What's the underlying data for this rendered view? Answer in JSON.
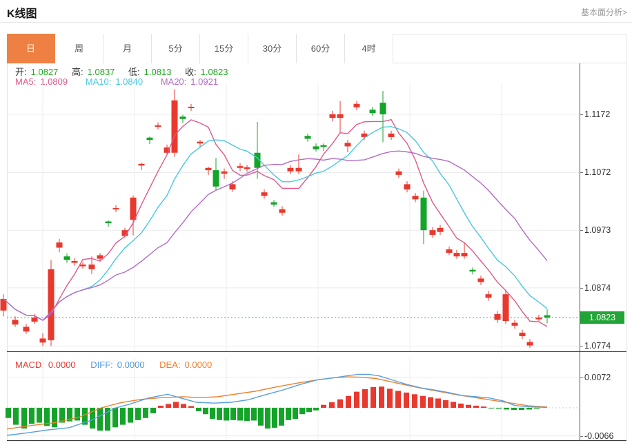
{
  "header": {
    "title": "K线图",
    "link": "基本面分析>"
  },
  "tabs": {
    "items": [
      "日",
      "周",
      "月",
      "5分",
      "15分",
      "30分",
      "60分",
      "4时"
    ],
    "active_index": 0
  },
  "ohlc": {
    "open_label": "开:",
    "open": "1.0827",
    "high_label": "高:",
    "high": "1.0837",
    "low_label": "低:",
    "low": "1.0813",
    "close_label": "收:",
    "close": "1.0823"
  },
  "ma": {
    "ma5_label": "MA5:",
    "ma5": "1.0809",
    "ma10_label": "MA10:",
    "ma10": "1.0840",
    "ma20_label": "MA20:",
    "ma20": "1.0921"
  },
  "macd_header": {
    "macd_label": "MACD:",
    "macd": "0.0000",
    "diff_label": "DIFF:",
    "diff": "0.0000",
    "dea_label": "DEA:",
    "dea": "0.0000"
  },
  "axis": {
    "main_ticks": [
      "1.1172",
      "1.1072",
      "1.0973",
      "1.0874",
      "1.0774"
    ],
    "last_price": "1.0823",
    "macd_tick_high": "0.0072",
    "macd_tick_low": "-0.0066"
  },
  "colors": {
    "up": "#e9382e",
    "down": "#14a42a",
    "badge": "#22a436",
    "ma5": "#e05788",
    "ma10": "#45c8e0",
    "ma20": "#b26bc5",
    "diff": "#58a0dd",
    "dea": "#ee7f2d",
    "active_tab": "#ee8043",
    "grid": "#ececec",
    "dotted_price": "#3cb954",
    "macd_zero_dotted": "#aed0ee",
    "ohlc_value": "#21a821"
  },
  "chart_data": {
    "type": "candlestick_with_macd",
    "main": {
      "title": "",
      "ylim": [
        1.0765,
        1.1224
      ],
      "tick_prices": [
        1.1172,
        1.1072,
        1.0973,
        1.0874,
        1.0774
      ],
      "last_price": 1.0823,
      "grid_x": [
        62,
        195,
        328,
        461,
        594,
        727
      ],
      "ma_periods": [
        5,
        10,
        20
      ],
      "candles": [
        [
          5,
          1.0835,
          1.0863,
          1.0825,
          1.0855
        ],
        [
          22,
          1.0811,
          1.0825,
          1.0807,
          1.0819
        ],
        [
          38,
          1.0799,
          1.0812,
          1.0795,
          1.0807
        ],
        [
          50,
          1.0816,
          1.0829,
          1.0812,
          1.0823
        ],
        [
          62,
          1.078,
          1.0796,
          1.0774,
          1.0787
        ],
        [
          74,
          1.0784,
          1.0922,
          1.0774,
          1.0906
        ],
        [
          86,
          1.0943,
          1.0958,
          1.0935,
          1.0952
        ],
        [
          97,
          1.0928,
          1.0933,
          1.0917,
          1.0922
        ],
        [
          108,
          1.0917,
          1.0925,
          1.0912,
          1.092
        ],
        [
          120,
          1.0911,
          1.0918,
          1.0907,
          1.0914
        ],
        [
          133,
          1.0906,
          1.0928,
          1.0898,
          1.0914
        ],
        [
          145,
          1.0924,
          1.0934,
          1.0919,
          1.093
        ],
        [
          157,
          1.0988,
          1.099,
          1.0979,
          1.0985
        ],
        [
          168,
          1.1009,
          1.1016,
          1.1004,
          1.1011
        ],
        [
          181,
          1.0963,
          1.0977,
          1.096,
          1.0973
        ],
        [
          193,
          1.0991,
          1.1033,
          1.0964,
          1.1029
        ],
        [
          205,
          1.1084,
          1.1089,
          1.1076,
          1.1087
        ],
        [
          217,
          1.1132,
          1.1134,
          1.1121,
          1.1128
        ],
        [
          229,
          1.1151,
          1.1158,
          1.1146,
          1.1153
        ],
        [
          242,
          1.1106,
          1.112,
          1.1102,
          1.1115
        ],
        [
          253,
          1.1106,
          1.1215,
          1.1099,
          1.1196
        ],
        [
          265,
          1.1168,
          1.1171,
          1.1157,
          1.1164
        ],
        [
          277,
          1.1183,
          1.119,
          1.1178,
          1.1185
        ],
        [
          290,
          1.1122,
          1.1128,
          1.1116,
          1.1125
        ],
        [
          302,
          1.1076,
          1.1082,
          1.1068,
          1.108
        ],
        [
          313,
          1.1076,
          1.1097,
          1.1041,
          1.1048
        ],
        [
          325,
          1.107,
          1.1079,
          1.1061,
          1.1074
        ],
        [
          337,
          1.1043,
          1.1057,
          1.1039,
          1.1052
        ],
        [
          348,
          1.108,
          1.1088,
          1.1075,
          1.1083
        ],
        [
          358,
          1.1078,
          1.1085,
          1.1073,
          1.1081
        ],
        [
          373,
          1.1106,
          1.1159,
          1.1061,
          1.108
        ],
        [
          383,
          1.1032,
          1.1043,
          1.1027,
          1.1038
        ],
        [
          397,
          1.1021,
          1.1025,
          1.1013,
          1.1017
        ],
        [
          409,
          1.1003,
          1.1014,
          1.0998,
          1.1009
        ],
        [
          421,
          1.1074,
          1.1085,
          1.1069,
          1.108
        ],
        [
          433,
          1.1074,
          1.1103,
          1.1069,
          1.108
        ],
        [
          446,
          1.1135,
          1.1139,
          1.1125,
          1.113
        ],
        [
          458,
          1.1117,
          1.1122,
          1.1108,
          1.1112
        ],
        [
          469,
          1.1119,
          1.1122,
          1.1109,
          1.1116
        ],
        [
          482,
          1.1166,
          1.1178,
          1.116,
          1.1172
        ],
        [
          493,
          1.1166,
          1.1195,
          1.1139,
          1.1172
        ],
        [
          504,
          1.1117,
          1.1128,
          1.1107,
          1.1123
        ],
        [
          517,
          1.1184,
          1.1195,
          1.1179,
          1.119
        ],
        [
          528,
          1.1133,
          1.1144,
          1.1128,
          1.1139
        ],
        [
          540,
          1.118,
          1.1185,
          1.1169,
          1.1174
        ],
        [
          555,
          1.1192,
          1.1212,
          1.1124,
          1.1172
        ],
        [
          567,
          1.1133,
          1.1144,
          1.1128,
          1.1139
        ],
        [
          578,
          1.1068,
          1.1079,
          1.1063,
          1.1074
        ],
        [
          590,
          1.1043,
          1.1057,
          1.1038,
          1.1052
        ],
        [
          602,
          1.1026,
          1.1037,
          1.1021,
          1.1032
        ],
        [
          614,
          1.1029,
          1.1041,
          1.0949,
          1.0973
        ],
        [
          627,
          1.0965,
          1.0978,
          1.096,
          1.0973
        ],
        [
          638,
          1.097,
          1.0982,
          1.0965,
          1.0977
        ],
        [
          651,
          1.0934,
          1.0945,
          1.093,
          1.094
        ],
        [
          662,
          1.0928,
          1.0939,
          1.0924,
          1.0934
        ],
        [
          673,
          1.0928,
          1.0952,
          1.0924,
          1.0934
        ],
        [
          685,
          1.0905,
          1.0909,
          1.0897,
          1.0902
        ],
        [
          697,
          1.0884,
          1.0895,
          1.0879,
          1.089
        ],
        [
          708,
          1.0857,
          1.0869,
          1.0852,
          1.0863
        ],
        [
          721,
          1.0819,
          1.0834,
          1.0814,
          1.0829
        ],
        [
          733,
          1.0817,
          1.0869,
          1.0812,
          1.0863
        ],
        [
          746,
          1.0809,
          1.0819,
          1.0804,
          1.0814
        ],
        [
          757,
          1.0791,
          1.0802,
          1.0786,
          1.0797
        ],
        [
          768,
          1.0775,
          1.0786,
          1.0771,
          1.0781
        ],
        [
          781,
          1.082,
          1.0828,
          1.0815,
          1.0823
        ],
        [
          793,
          1.0827,
          1.0837,
          1.0813,
          1.0823
        ]
      ]
    },
    "macd": {
      "ylim": [
        -0.0078,
        0.0117
      ],
      "tick_values": [
        0.0072,
        -0.0066
      ],
      "grid_x": [
        62,
        195,
        328,
        461,
        594,
        727
      ],
      "histogram": [
        [
          12,
          -0.0024
        ],
        [
          23,
          -0.004
        ],
        [
          35,
          -0.0049
        ],
        [
          46,
          -0.0038
        ],
        [
          57,
          -0.0035
        ],
        [
          68,
          -0.0043
        ],
        [
          79,
          -0.0046
        ],
        [
          90,
          -0.0035
        ],
        [
          101,
          -0.0032
        ],
        [
          112,
          -0.003
        ],
        [
          123,
          -0.004
        ],
        [
          134,
          -0.0049
        ],
        [
          145,
          -0.0054
        ],
        [
          156,
          -0.0054
        ],
        [
          167,
          -0.0046
        ],
        [
          178,
          -0.004
        ],
        [
          189,
          -0.0035
        ],
        [
          200,
          -0.0029
        ],
        [
          211,
          -0.0024
        ],
        [
          222,
          -0.0013
        ],
        [
          233,
          0.0005
        ],
        [
          244,
          0.0009
        ],
        [
          255,
          0.0014
        ],
        [
          266,
          0.0009
        ],
        [
          277,
          0.0004
        ],
        [
          288,
          -0.0008
        ],
        [
          298,
          -0.0015
        ],
        [
          308,
          -0.0026
        ],
        [
          318,
          -0.0029
        ],
        [
          328,
          -0.003
        ],
        [
          338,
          -0.0029
        ],
        [
          348,
          -0.003
        ],
        [
          358,
          -0.0031
        ],
        [
          368,
          -0.003
        ],
        [
          378,
          -0.0042
        ],
        [
          388,
          -0.0049
        ],
        [
          398,
          -0.0047
        ],
        [
          408,
          -0.0042
        ],
        [
          418,
          -0.0029
        ],
        [
          428,
          -0.0026
        ],
        [
          438,
          -0.0015
        ],
        [
          448,
          -0.001
        ],
        [
          458,
          -0.0006
        ],
        [
          469,
          0.0007
        ],
        [
          481,
          0.0013
        ],
        [
          493,
          0.002
        ],
        [
          505,
          0.0028
        ],
        [
          517,
          0.0038
        ],
        [
          529,
          0.0044
        ],
        [
          541,
          0.0049
        ],
        [
          553,
          0.005
        ],
        [
          565,
          0.0045
        ],
        [
          577,
          0.004
        ],
        [
          589,
          0.0036
        ],
        [
          601,
          0.0032
        ],
        [
          613,
          0.0028
        ],
        [
          624,
          0.0025
        ],
        [
          635,
          0.0022
        ],
        [
          646,
          0.0018
        ],
        [
          657,
          0.0014
        ],
        [
          668,
          0.001
        ],
        [
          679,
          0.0007
        ],
        [
          690,
          0.0005
        ],
        [
          701,
          0.0003
        ],
        [
          712,
          -0.0001
        ],
        [
          723,
          -0.0002
        ],
        [
          734,
          -0.0004
        ],
        [
          745,
          -0.0005
        ],
        [
          756,
          -0.0005
        ],
        [
          767,
          -0.0004
        ],
        [
          778,
          -0.0002
        ]
      ],
      "diff_line": [
        [
          10,
          -0.0065
        ],
        [
          40,
          -0.0059
        ],
        [
          70,
          -0.0052
        ],
        [
          100,
          -0.0047
        ],
        [
          133,
          -0.0029
        ],
        [
          168,
          0.0
        ],
        [
          187,
          0.0008
        ],
        [
          215,
          0.0023
        ],
        [
          243,
          0.0032
        ],
        [
          262,
          0.0023
        ],
        [
          285,
          0.0013
        ],
        [
          310,
          0.0011
        ],
        [
          335,
          0.0013
        ],
        [
          360,
          0.0019
        ],
        [
          385,
          0.0031
        ],
        [
          410,
          0.0042
        ],
        [
          435,
          0.0055
        ],
        [
          460,
          0.0066
        ],
        [
          485,
          0.0071
        ],
        [
          505,
          0.0076
        ],
        [
          520,
          0.0079
        ],
        [
          535,
          0.0079
        ],
        [
          550,
          0.0075
        ],
        [
          570,
          0.0065
        ],
        [
          590,
          0.0055
        ],
        [
          610,
          0.0047
        ],
        [
          630,
          0.0042
        ],
        [
          650,
          0.0036
        ],
        [
          670,
          0.0029
        ],
        [
          690,
          0.0026
        ],
        [
          710,
          0.0023
        ],
        [
          730,
          0.0016
        ],
        [
          745,
          0.0006
        ],
        [
          760,
          0.0003
        ],
        [
          775,
          0.0002
        ],
        [
          793,
          0.0001
        ]
      ],
      "dea_line": [
        [
          10,
          -0.005
        ],
        [
          45,
          -0.0042
        ],
        [
          80,
          -0.0035
        ],
        [
          115,
          -0.0022
        ],
        [
          147,
          0.0
        ],
        [
          175,
          0.0012
        ],
        [
          205,
          0.002
        ],
        [
          235,
          0.0024
        ],
        [
          265,
          0.0026
        ],
        [
          290,
          0.0024
        ],
        [
          315,
          0.0026
        ],
        [
          340,
          0.0032
        ],
        [
          370,
          0.0039
        ],
        [
          400,
          0.0049
        ],
        [
          430,
          0.0058
        ],
        [
          460,
          0.0066
        ],
        [
          485,
          0.0071
        ],
        [
          505,
          0.0073
        ],
        [
          525,
          0.0072
        ],
        [
          545,
          0.0069
        ],
        [
          565,
          0.0062
        ],
        [
          585,
          0.0055
        ],
        [
          605,
          0.0048
        ],
        [
          625,
          0.0042
        ],
        [
          645,
          0.0036
        ],
        [
          665,
          0.003
        ],
        [
          685,
          0.0025
        ],
        [
          705,
          0.002
        ],
        [
          725,
          0.0015
        ],
        [
          745,
          0.001
        ],
        [
          765,
          0.0005
        ],
        [
          793,
          0.0002
        ]
      ],
      "flat_dotted_from_x": 793
    }
  }
}
